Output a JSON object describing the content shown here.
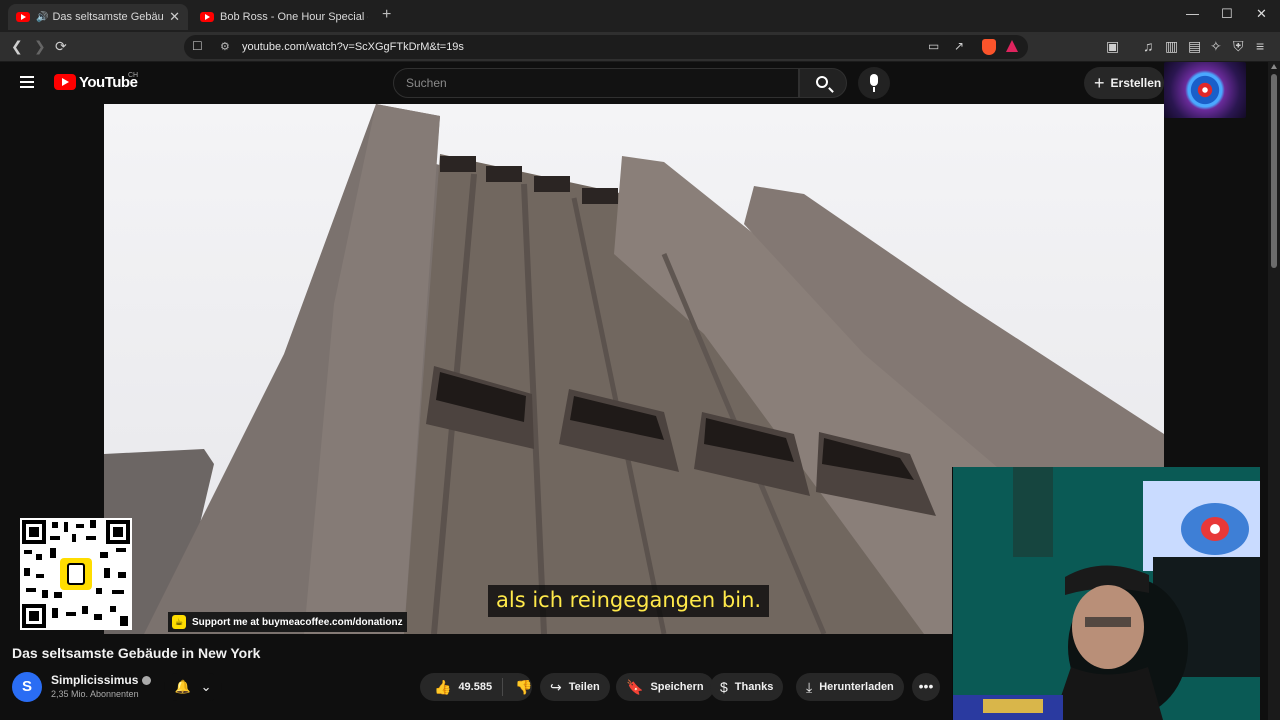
{
  "browser": {
    "tabs": [
      {
        "title": "Das seltsamste Gebäude in N",
        "active": true,
        "audio": true
      },
      {
        "title": "Bob Ross - One Hour Special - The G",
        "active": false
      }
    ],
    "new_tab_symbol": "+",
    "window_controls": [
      "—",
      "☐",
      "✕"
    ],
    "url": "youtube.com/watch?v=ScXGgFTkDrM&t=19s"
  },
  "youtube": {
    "logo_text": "YouTube",
    "country": "CH",
    "search_placeholder": "Suchen",
    "create_label": "Erstellen",
    "create_icon": "+"
  },
  "video": {
    "subtitle": "als ich reingegangen bin.",
    "support_text": "Support me at buymeacoffee.com/donationz",
    "title": "Das seltsamste Gebäude in New York"
  },
  "channel": {
    "initial": "S",
    "name": "Simplicissimus",
    "subscribers": "2,35 Mio. Abonnenten"
  },
  "actions": {
    "likes": "49.585",
    "share": "Teilen",
    "save": "Speichern",
    "thanks": "Thanks",
    "download": "Herunterladen",
    "more": "•••"
  },
  "icons": {
    "like": "👍",
    "dislike": "👎",
    "share": "↪",
    "save": "🔖",
    "thanks": "$",
    "download": "⤓",
    "bell": "🔔",
    "chevron": "⌄"
  },
  "colors": {
    "yt_red": "#ff0000",
    "subtitle_yellow": "#ffe94a",
    "page_bg": "#0f0f0f"
  }
}
